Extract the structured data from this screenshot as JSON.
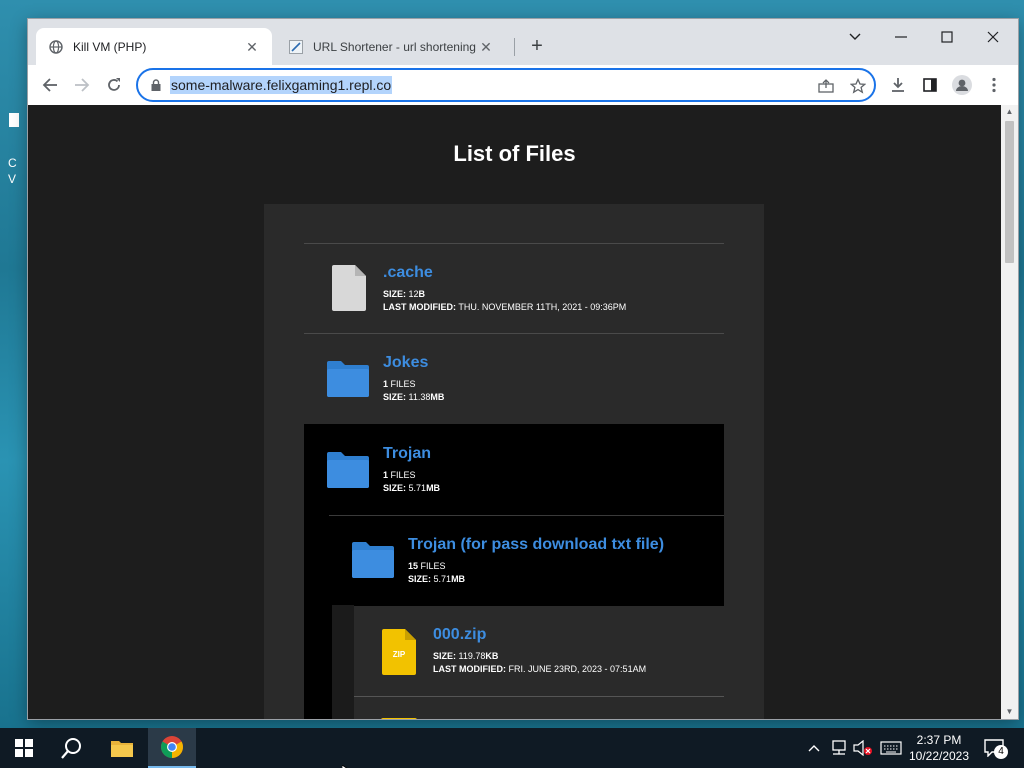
{
  "desktop": {
    "frag1": "C",
    "frag2": "V"
  },
  "browser": {
    "tabs": [
      {
        "title": "Kill VM (PHP)"
      },
      {
        "title": "URL Shortener - url shortening s"
      }
    ],
    "url": "some-malware.felixgaming1.repl.co"
  },
  "page": {
    "title": "List of Files",
    "entries": [
      {
        "name": ".cache",
        "kind": "file",
        "size_label": "SIZE:",
        "size": "12",
        "size_unit": "B",
        "modified_label": "LAST MODIFIED:",
        "modified": "THU. NOVEMBER 11TH, 2021 - 09:36PM"
      },
      {
        "name": "Jokes",
        "kind": "folder",
        "count": "1",
        "count_label": "FILES",
        "size_label": "SIZE:",
        "size": "11.38",
        "size_unit": "MB"
      },
      {
        "name": "Trojan",
        "kind": "folder",
        "count": "1",
        "count_label": "FILES",
        "size_label": "SIZE:",
        "size": "5.71",
        "size_unit": "MB"
      },
      {
        "name": "Trojan (for pass download txt file)",
        "kind": "folder",
        "count": "15",
        "count_label": "FILES",
        "size_label": "SIZE:",
        "size": "5.71",
        "size_unit": "MB"
      },
      {
        "name": "000.zip",
        "kind": "zip",
        "zip_text": "ZIP",
        "size_label": "SIZE:",
        "size": "119.78",
        "size_unit": "KB",
        "modified_label": "LAST MODIFIED:",
        "modified": "FRI. JUNE 23RD, 2023 - 07:51AM"
      }
    ]
  },
  "taskbar": {
    "time": "2:37 PM",
    "date": "10/22/2023",
    "notifications": "4"
  },
  "colors": {
    "accent": "#1a73e8",
    "link": "#3d8de0",
    "page_bg": "#1d1d1d",
    "panel_bg": "#2a2a2a"
  }
}
